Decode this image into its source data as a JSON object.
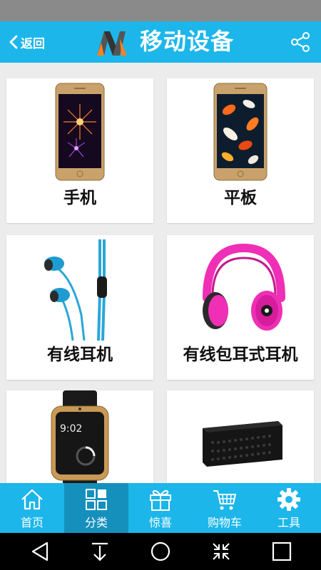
{
  "header": {
    "back_label": "返回",
    "title": "移动设备"
  },
  "categories": [
    {
      "label": "手机"
    },
    {
      "label": "平板"
    },
    {
      "label": "有线耳机"
    },
    {
      "label": "有线包耳式耳机"
    },
    {
      "label": ""
    },
    {
      "label": ""
    }
  ],
  "tabs": [
    {
      "label": "首页",
      "icon": "home-icon"
    },
    {
      "label": "分类",
      "icon": "grid-icon"
    },
    {
      "label": "惊喜",
      "icon": "gift-icon"
    },
    {
      "label": "购物车",
      "icon": "cart-icon"
    },
    {
      "label": "工具",
      "icon": "gear-icon"
    }
  ],
  "watch_time": "9:02",
  "colors": {
    "accent": "#1cb6ea",
    "active_tab": "#1590bd",
    "background": "#ececec"
  }
}
